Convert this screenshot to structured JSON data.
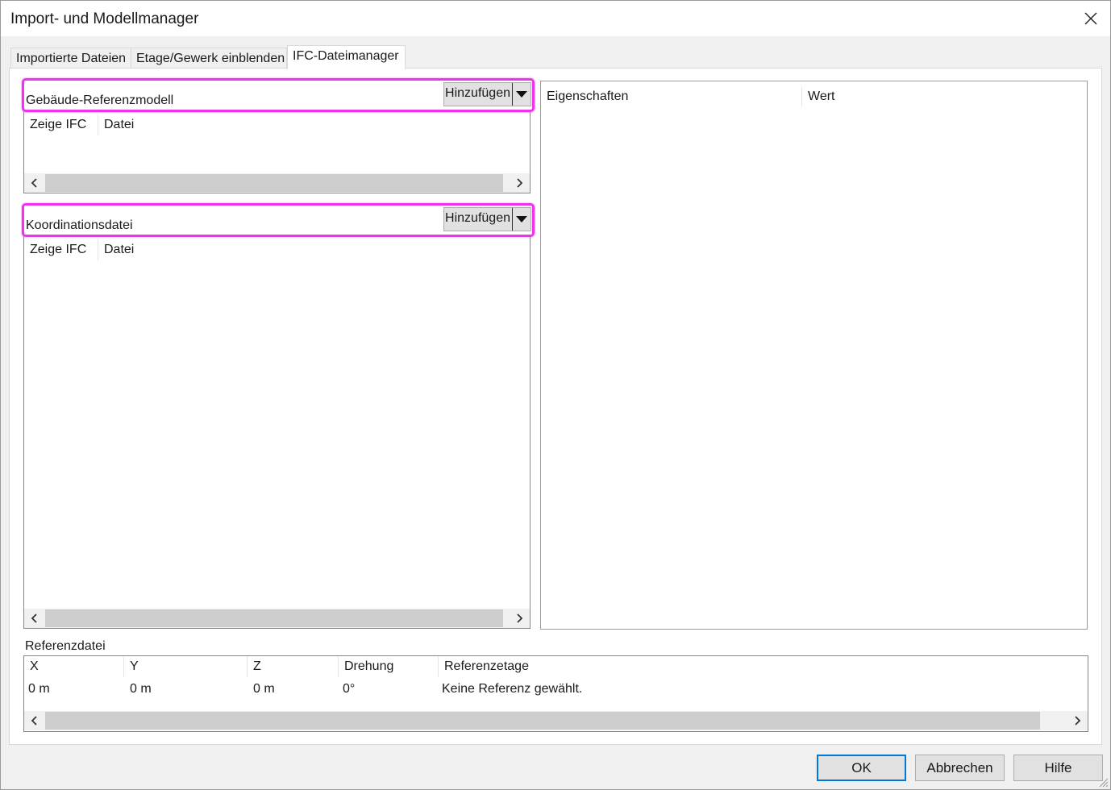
{
  "window": {
    "title": "Import- und Modellmanager"
  },
  "tabs": [
    {
      "label": "Importierte Dateien"
    },
    {
      "label": "Etage/Gewerk einblenden"
    },
    {
      "label": "IFC-Dateimanager"
    }
  ],
  "active_tab": "IFC-Dateimanager",
  "building_model": {
    "label": "Gebäude-Referenzmodell",
    "add_label": "Hinzufügen",
    "columns": [
      "Zeige IFC",
      "Datei"
    ],
    "rows": []
  },
  "coordination": {
    "label": "Koordinationsdatei",
    "add_label": "Hinzufügen",
    "columns": [
      "Zeige IFC",
      "Datei"
    ],
    "rows": []
  },
  "properties": {
    "columns": [
      "Eigenschaften",
      "Wert"
    ],
    "rows": []
  },
  "reference": {
    "label": "Referenzdatei",
    "columns": [
      "X",
      "Y",
      "Z",
      "Drehung",
      "Referenzetage"
    ],
    "row": [
      "0 m",
      "0 m",
      "0 m",
      "0°",
      "Keine Referenz gewählt."
    ]
  },
  "buttons": {
    "ok": "OK",
    "cancel": "Abbrechen",
    "help": "Hilfe"
  },
  "colors": {
    "highlight": "#ee33ee",
    "default_button_border": "#0078d7"
  },
  "icons": {
    "close": "close-icon",
    "dropdown": "caret-down-icon",
    "scroll_left": "chevron-left-icon",
    "scroll_right": "chevron-right-icon"
  }
}
